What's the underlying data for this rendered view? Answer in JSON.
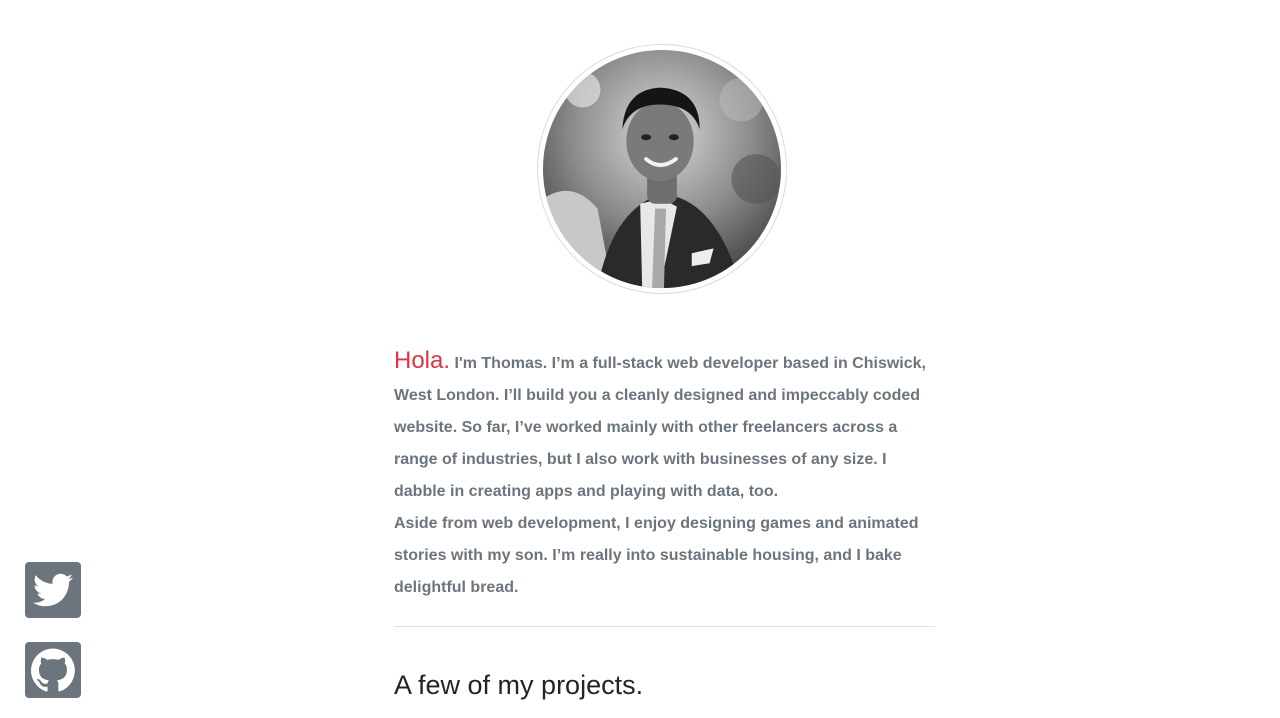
{
  "profile": {
    "greeting": "Hola.",
    "intro_text": " I'm Thomas. I’m a full-stack web developer based in Chiswick, West London. I’ll build you a cleanly designed and impeccably coded website. So far, I’ve worked mainly with other freelancers across a range of industries, but I also work with businesses of any size. I dabble in creating apps and playing with data, too.",
    "aside_text": "Aside from web development, I enjoy designing games and animated stories with my son. I’m really into sustainable housing, and I bake delightful bread."
  },
  "projects": {
    "heading": "A few of my projects."
  },
  "social": [
    {
      "icon": "twitter-icon"
    },
    {
      "icon": "github-icon"
    }
  ],
  "colors": {
    "accent": "#dc3545",
    "text_muted": "#6c757d",
    "heading": "#212529",
    "icon_bg": "#6c757d"
  }
}
